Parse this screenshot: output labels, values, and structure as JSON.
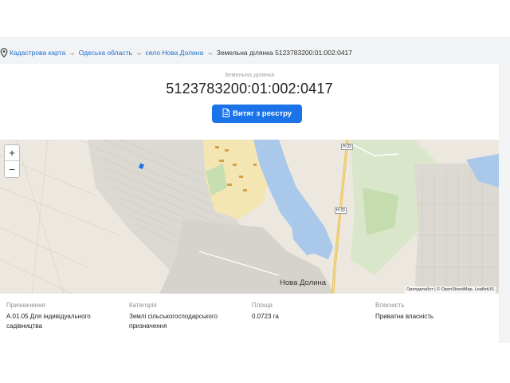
{
  "breadcrumb": {
    "items": [
      "Кадастрова карта",
      "Одеська область",
      "село Нова Долина"
    ],
    "current": "Земельна ділянка 5123783200:01:002:0417",
    "separator": "→"
  },
  "parcel": {
    "label": "Земельна ділянка",
    "cadastral_number": "5123783200:01:002:0417",
    "extract_button": "Витяг з реєстру"
  },
  "map": {
    "zoom_in": "+",
    "zoom_out": "−",
    "attribution": "Openдатабот | © OpenStreetMap, LeafletUS",
    "place_label": "Нова Долина",
    "road_label": "Н-33"
  },
  "details": {
    "purpose": {
      "label": "Призначення",
      "value": "A.01.05 Для індивідуального садівництва"
    },
    "category": {
      "label": "Категорія",
      "value": "Землі сільськогосподарського призначення"
    },
    "area": {
      "label": "Площа",
      "value": "0.0723 га"
    },
    "ownership": {
      "label": "Власність",
      "value": "Приватна власність"
    }
  }
}
